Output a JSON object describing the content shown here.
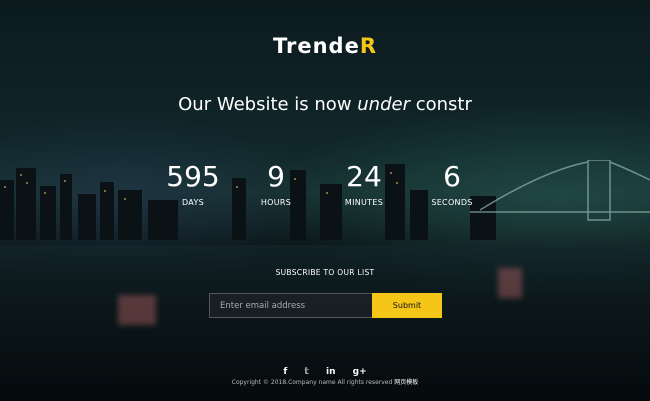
{
  "logo": {
    "main": "Trende",
    "accent": "R"
  },
  "headline": {
    "before": "Our Website is now ",
    "emphasis": "under",
    "after": " constr"
  },
  "countdown": [
    {
      "value": "595",
      "label": "DAYS"
    },
    {
      "value": "9",
      "label": "HOURS"
    },
    {
      "value": "24",
      "label": "MINUTES"
    },
    {
      "value": "6",
      "label": "SECONDS"
    }
  ],
  "subscribe": {
    "title": "SUBSCRIBE TO OUR LIST",
    "placeholder": "Enter email address",
    "button": "Submit"
  },
  "social": {
    "facebook": "f",
    "twitter": "𝕥",
    "linkedin": "in",
    "googleplus": "g+"
  },
  "footer": {
    "copyright": "Copyright © 2018.Company name All rights reserved",
    "link": "网页模板"
  },
  "colors": {
    "accent": "#f5c518",
    "background": "#0b1418"
  }
}
